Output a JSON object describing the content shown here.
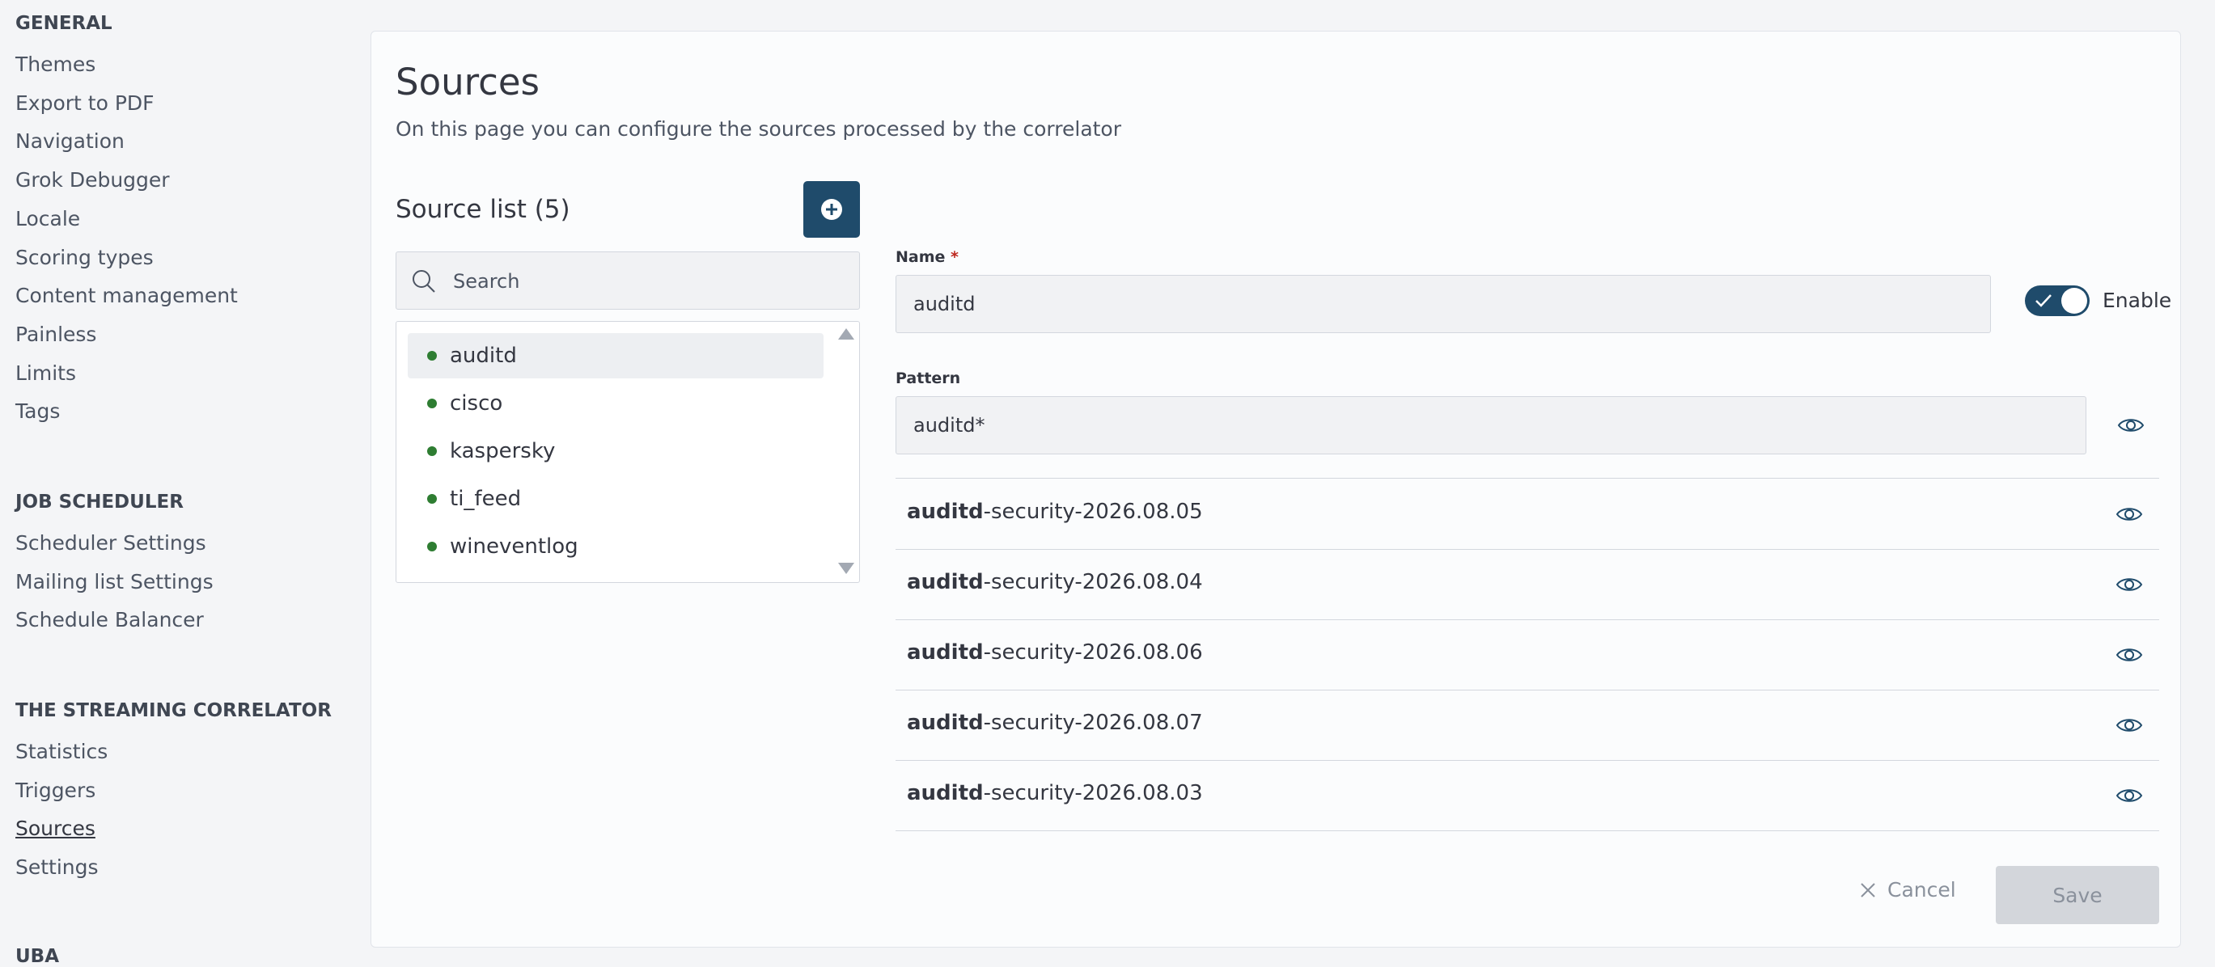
{
  "sidebar": {
    "sections": [
      {
        "title": "GENERAL",
        "items": [
          "Themes",
          "Export to PDF",
          "Navigation",
          "Grok Debugger",
          "Locale",
          "Scoring types",
          "Content management",
          "Painless",
          "Limits",
          "Tags"
        ]
      },
      {
        "title": "JOB SCHEDULER",
        "items": [
          "Scheduler Settings",
          "Mailing list Settings",
          "Schedule Balancer"
        ]
      },
      {
        "title": "THE STREAMING CORRELATOR",
        "items": [
          "Statistics",
          "Triggers",
          "Sources",
          "Settings"
        ],
        "active": "Sources"
      }
    ],
    "cut_section_title": "UBA"
  },
  "page": {
    "title": "Sources",
    "description": "On this page you can configure the sources processed by the correlator"
  },
  "source_list": {
    "title": "Source list (5)",
    "search_placeholder": "Search",
    "items": [
      "auditd",
      "cisco",
      "kaspersky",
      "ti_feed",
      "wineventlog"
    ],
    "selected": "auditd",
    "status_color": "#2e7d32"
  },
  "form": {
    "name_label": "Name",
    "required_mark": "*",
    "name_value": "auditd",
    "enable_label": "Enable",
    "enabled": true,
    "pattern_label": "Pattern",
    "pattern_value": "auditd*"
  },
  "indices": [
    {
      "prefix": "auditd",
      "suffix": "-security-2026.08.05"
    },
    {
      "prefix": "auditd",
      "suffix": "-security-2026.08.04"
    },
    {
      "prefix": "auditd",
      "suffix": "-security-2026.08.06"
    },
    {
      "prefix": "auditd",
      "suffix": "-security-2026.08.07"
    },
    {
      "prefix": "auditd",
      "suffix": "-security-2026.08.03"
    }
  ],
  "actions": {
    "cancel_label": "Cancel",
    "save_label": "Save"
  },
  "colors": {
    "accent": "#1f4b6b",
    "status_ok": "#2e7d32",
    "required": "#bd271e"
  }
}
